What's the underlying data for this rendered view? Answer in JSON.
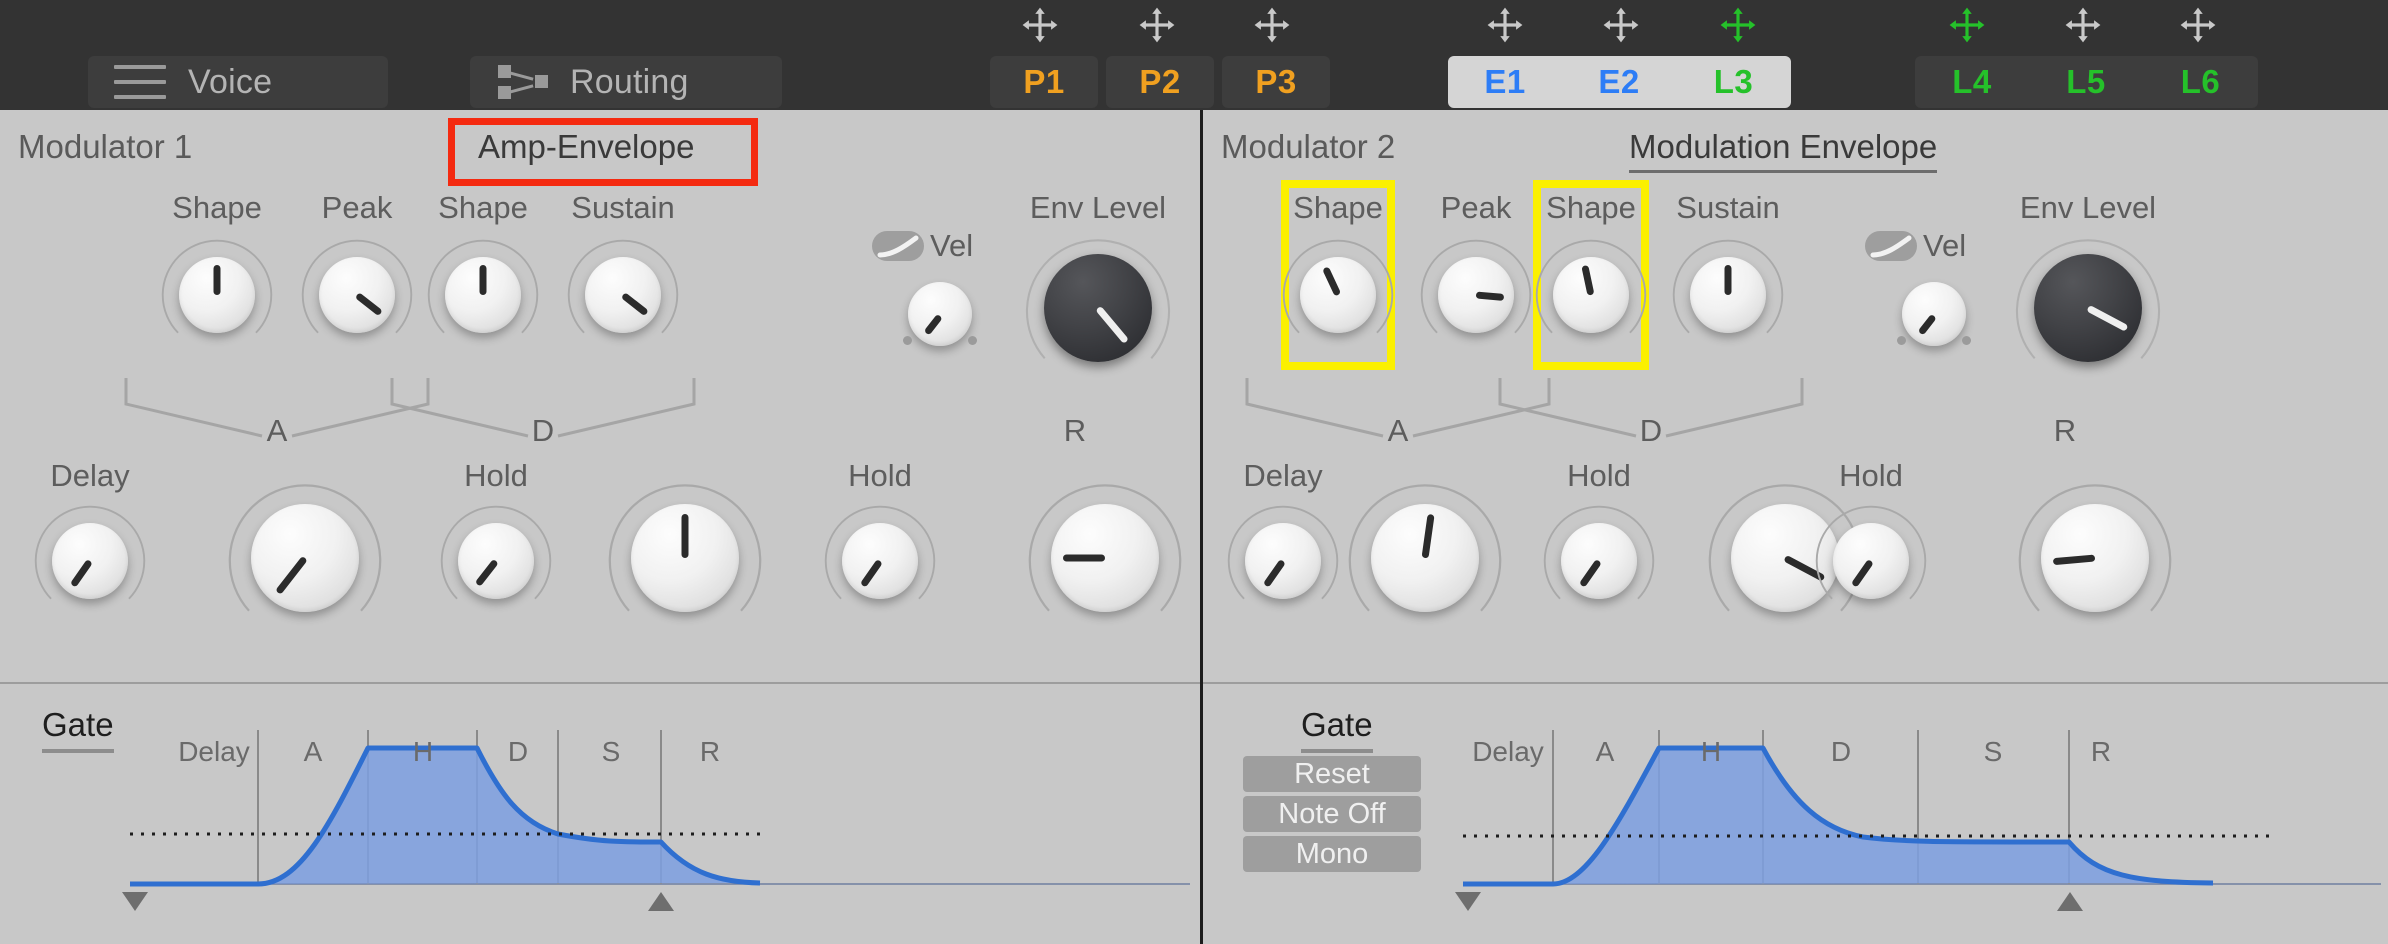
{
  "topbar": {
    "buttons": [
      {
        "label": "Voice",
        "icon": "hamburger-menu-icon"
      },
      {
        "label": "Routing",
        "icon": "routing-node-icon"
      }
    ],
    "tab_groups": [
      {
        "group": "pitch",
        "active": false,
        "tabs": [
          {
            "label": "P1",
            "color": "#f0a020",
            "move_icon_color": "#c9c9c9"
          },
          {
            "label": "P2",
            "color": "#f0a020",
            "move_icon_color": "#c9c9c9"
          },
          {
            "label": "P3",
            "color": "#f0a020",
            "move_icon_color": "#c9c9c9"
          }
        ]
      },
      {
        "group": "env-lfo-a",
        "active": true,
        "tabs": [
          {
            "label": "E1",
            "color": "#2d7df6",
            "move_icon_color": "#c9c9c9"
          },
          {
            "label": "E2",
            "color": "#2d7df6",
            "move_icon_color": "#c9c9c9"
          },
          {
            "label": "L3",
            "color": "#25b game",
            "move_icon_color": "#25c12a"
          }
        ]
      },
      {
        "group": "lfo-b",
        "active": false,
        "tabs": [
          {
            "label": "L4",
            "color": "#25c12a",
            "move_icon_color": "#25c12a"
          },
          {
            "label": "L5",
            "color": "#25c12a",
            "move_icon_color": "#c9c9c9"
          },
          {
            "label": "L6",
            "color": "#25c12a",
            "move_icon_color": "#c9c9c9"
          }
        ]
      }
    ],
    "move_icon_name": "move-cross-arrows-icon"
  },
  "panels": [
    {
      "id": "modulator-1",
      "modulator_title": "Modulator 1",
      "envelope_title": "Amp-Envelope",
      "envelope_title_underlined": false,
      "highlight": {
        "type": "red-box",
        "target": "envelope-title"
      },
      "knobs_top": [
        {
          "name": "shape-attack",
          "label": "Shape",
          "angle": 0,
          "size": "md",
          "style": "light"
        },
        {
          "name": "peak",
          "label": "Peak",
          "angle": 128,
          "size": "md",
          "style": "light"
        },
        {
          "name": "shape-decay",
          "label": "Shape",
          "angle": 0,
          "size": "md",
          "style": "light"
        },
        {
          "name": "sustain",
          "label": "Sustain",
          "angle": 128,
          "size": "md",
          "style": "light"
        },
        {
          "name": "velocity",
          "label": "",
          "angle": 218,
          "size": "sm",
          "style": "light"
        },
        {
          "name": "env-level",
          "label": "Env Level",
          "angle": 140,
          "size": "lg",
          "style": "dark"
        }
      ],
      "vel_toggle": {
        "label": "Vel",
        "icon": "velocity-curve-icon",
        "on": false
      },
      "brackets": [
        {
          "label": "A"
        },
        {
          "label": "D"
        }
      ],
      "knobs_bottom": [
        {
          "name": "delay",
          "label": "Delay",
          "angle": 215,
          "size": "md",
          "style": "light"
        },
        {
          "name": "attack",
          "label": "",
          "angle": 218,
          "size": "lg",
          "style": "light"
        },
        {
          "name": "hold-1",
          "label": "Hold",
          "angle": 218,
          "size": "md",
          "style": "light"
        },
        {
          "name": "decay",
          "label": "",
          "angle": 0,
          "size": "lg",
          "style": "light"
        },
        {
          "name": "hold-2",
          "label": "Hold",
          "angle": 215,
          "size": "md",
          "style": "light"
        },
        {
          "name": "release",
          "label": "",
          "angle": 270,
          "size": "lg",
          "style": "light"
        }
      ],
      "bottom_labels": [
        "R"
      ],
      "graph": {
        "gate_label": "Gate",
        "gate_buttons": [],
        "stage_labels": [
          "Delay",
          "A",
          "H",
          "D",
          "S",
          "R"
        ],
        "start_marker": "down-triangle",
        "end_marker": "up-triangle"
      }
    },
    {
      "id": "modulator-2",
      "modulator_title": "Modulator 2",
      "envelope_title": "Modulation Envelope",
      "envelope_title_underlined": true,
      "highlight": {
        "type": "yellow-box",
        "targets": [
          "shape-attack",
          "shape-decay"
        ]
      },
      "knobs_top": [
        {
          "name": "shape-attack",
          "label": "Shape",
          "angle": 335,
          "size": "md",
          "style": "light"
        },
        {
          "name": "peak",
          "label": "Peak",
          "angle": 95,
          "size": "md",
          "style": "light"
        },
        {
          "name": "shape-decay",
          "label": "Shape",
          "angle": 348,
          "size": "md",
          "style": "light"
        },
        {
          "name": "sustain",
          "label": "Sustain",
          "angle": 0,
          "size": "md",
          "style": "light"
        },
        {
          "name": "velocity",
          "label": "",
          "angle": 218,
          "size": "sm",
          "style": "light"
        },
        {
          "name": "env-level",
          "label": "Env Level",
          "angle": 118,
          "size": "lg",
          "style": "dark"
        }
      ],
      "vel_toggle": {
        "label": "Vel",
        "icon": "velocity-curve-icon",
        "on": false
      },
      "brackets": [
        {
          "label": "A"
        },
        {
          "label": "D"
        }
      ],
      "knobs_bottom": [
        {
          "name": "delay",
          "label": "Delay",
          "angle": 215,
          "size": "md",
          "style": "light"
        },
        {
          "name": "attack",
          "label": "",
          "angle": 8,
          "size": "lg",
          "style": "light"
        },
        {
          "name": "hold-1",
          "label": "Hold",
          "angle": 215,
          "size": "md",
          "style": "light"
        },
        {
          "name": "decay",
          "label": "",
          "angle": 118,
          "size": "lg",
          "style": "light"
        },
        {
          "name": "hold-2",
          "label": "Hold",
          "angle": 215,
          "size": "md",
          "style": "light"
        },
        {
          "name": "release",
          "label": "",
          "angle": 265,
          "size": "lg",
          "style": "light"
        }
      ],
      "bottom_labels": [
        "R"
      ],
      "graph": {
        "gate_label": "Gate",
        "gate_buttons": [
          "Reset",
          "Note Off",
          "Mono"
        ],
        "stage_labels": [
          "Delay",
          "A",
          "H",
          "D",
          "S",
          "R"
        ],
        "start_marker": "down-triangle",
        "end_marker": "up-triangle"
      }
    }
  ],
  "colors": {
    "panel_bg": "#c8c8c8",
    "topbar_bg": "#333333",
    "envelope_stroke": "#2f6fd0",
    "envelope_fill": "#7d9fe0",
    "highlight_red": "#f42a10",
    "highlight_yellow": "#fbf000",
    "accent_pitch": "#f0a020",
    "accent_env": "#2d7df6",
    "accent_lfo": "#25c12a"
  },
  "chart_data": [
    {
      "type": "area",
      "name": "amp-envelope-curve",
      "title": "Amp-Envelope",
      "stages": [
        "Delay",
        "A",
        "H",
        "D",
        "S",
        "R"
      ],
      "stage_boundaries_pct": [
        0,
        21,
        37,
        53,
        70,
        85,
        100
      ],
      "sustain_level": 0.4,
      "peak_level": 1.0,
      "curve_points": [
        {
          "x": 0.0,
          "y": 0.0
        },
        {
          "x": 0.21,
          "y": 0.0
        },
        {
          "x": 0.37,
          "y": 1.0
        },
        {
          "x": 0.53,
          "y": 1.0
        },
        {
          "x": 0.7,
          "y": 0.44
        },
        {
          "x": 0.85,
          "y": 0.4
        },
        {
          "x": 0.92,
          "y": 0.12
        },
        {
          "x": 1.0,
          "y": 0.02
        }
      ],
      "dotted_guide_level": 0.4
    },
    {
      "type": "area",
      "name": "modulation-envelope-curve",
      "title": "Modulation Envelope",
      "stages": [
        "Delay",
        "A",
        "H",
        "D",
        "S",
        "R"
      ],
      "stage_boundaries_pct": [
        0,
        17,
        36,
        52,
        70,
        84,
        100
      ],
      "sustain_level": 0.42,
      "peak_level": 1.0,
      "curve_points": [
        {
          "x": 0.0,
          "y": 0.0
        },
        {
          "x": 0.17,
          "y": 0.0
        },
        {
          "x": 0.36,
          "y": 1.0
        },
        {
          "x": 0.52,
          "y": 1.0
        },
        {
          "x": 0.7,
          "y": 0.46
        },
        {
          "x": 0.84,
          "y": 0.42
        },
        {
          "x": 0.92,
          "y": 0.1
        },
        {
          "x": 1.0,
          "y": 0.01
        }
      ],
      "dotted_guide_level": 0.42
    }
  ]
}
